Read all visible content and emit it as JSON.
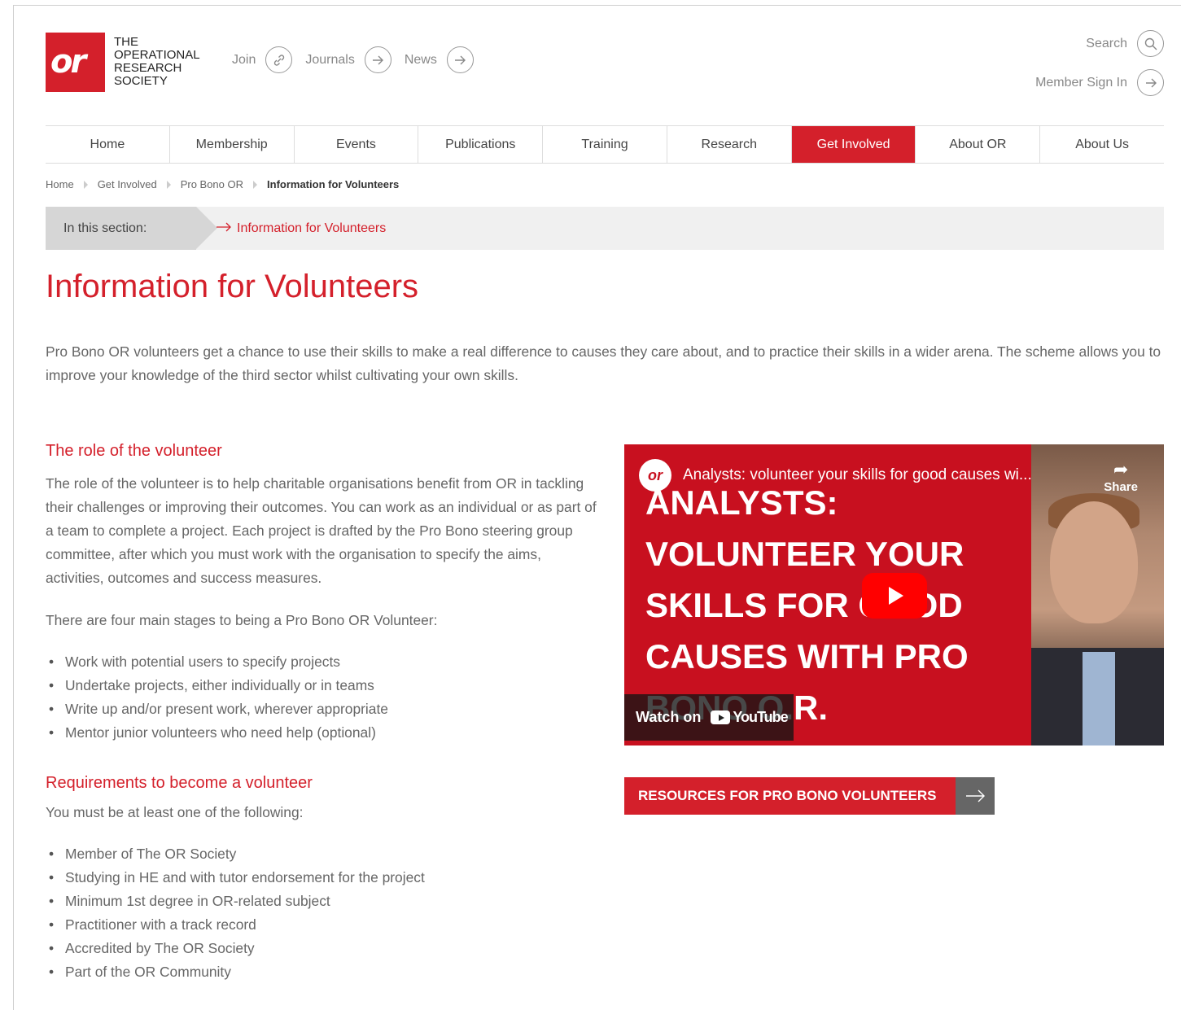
{
  "logo": {
    "mark": "or",
    "lines": [
      "THE",
      "OPERATIONAL",
      "RESEARCH",
      "SOCIETY"
    ]
  },
  "toplinks": [
    {
      "label": "Join",
      "icon": "link-icon"
    },
    {
      "label": "Journals",
      "icon": "arrow-right-icon"
    },
    {
      "label": "News",
      "icon": "arrow-right-icon"
    }
  ],
  "rightlinks": {
    "search": "Search",
    "signin": "Member Sign In"
  },
  "nav": [
    "Home",
    "Membership",
    "Events",
    "Publications",
    "Training",
    "Research",
    "Get Involved",
    "About OR",
    "About Us"
  ],
  "nav_active": "Get Involved",
  "breadcrumb": [
    "Home",
    "Get Involved",
    "Pro Bono OR",
    "Information for Volunteers"
  ],
  "section": {
    "label": "In this section:",
    "link": "Information for Volunteers"
  },
  "page_title": "Information for Volunteers",
  "intro": "Pro Bono OR volunteers get a chance to use their skills to make a real difference  to causes they care about, and to practice their skills in a wider arena. The scheme allows you to improve your knowledge of the third sector whilst cultivating your own skills.",
  "role": {
    "heading": "The role of the volunteer",
    "para1": "The role of the volunteer is to help charitable organisations benefit from OR in tackling their challenges or improving their outcomes. You can work as an individual or as part of a team to complete a project. Each project is drafted by the Pro Bono steering group committee, after which you must work with the organisation to specify the aims, activities, outcomes and success measures.",
    "para2": "There are four main stages to being a Pro Bono OR Volunteer:",
    "stages": [
      "Work with potential users to specify projects",
      "Undertake projects, either individually or in teams",
      "Write up and/or present work, wherever appropriate",
      "Mentor junior volunteers who need help (optional)"
    ]
  },
  "requirements": {
    "heading": "Requirements to become a volunteer",
    "para": "You must be at least one of the following:",
    "items": [
      "Member of The OR Society",
      "Studying in HE and with tutor endorsement for the project",
      "Minimum 1st degree in OR-related subject",
      "Practitioner with a track record",
      "Accredited by The OR Society",
      "Part of the OR Community"
    ]
  },
  "video": {
    "logo": "or",
    "caption": "Analysts: volunteer your skills for good causes wi...",
    "share": "Share",
    "big_text": "ANALYSTS: VOLUNTEER YOUR SKILLS FOR GOOD CAUSES WITH PRO BONO O.R.",
    "watch_on": "Watch on",
    "youtube": "YouTube"
  },
  "resource_button": "RESOURCES FOR PRO BONO VOLUNTEERS",
  "colors": {
    "brand_red": "#d4202b",
    "youtube_red": "#ff0000"
  }
}
